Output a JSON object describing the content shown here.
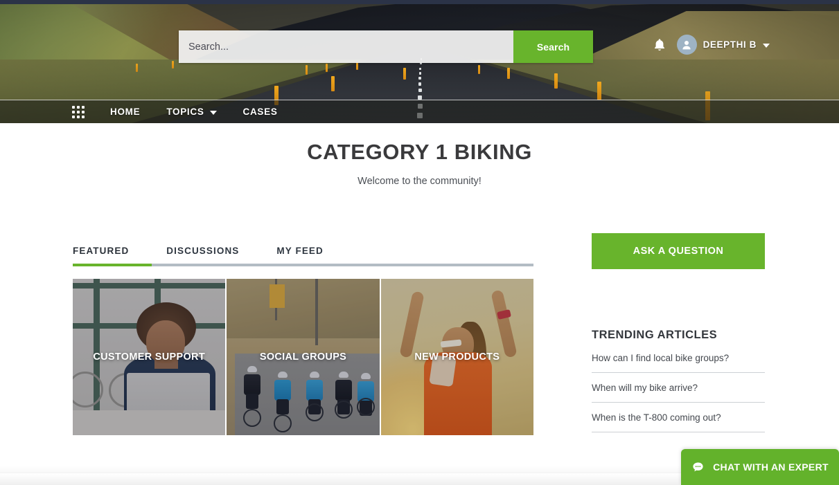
{
  "header": {
    "search": {
      "placeholder": "Search...",
      "value": "",
      "button_label": "Search"
    },
    "notifications_icon": "bell-icon",
    "user": {
      "name": "DEEPTHI B",
      "avatar_icon": "person-avatar-icon",
      "caret_icon": "chevron-down-icon"
    }
  },
  "nav": {
    "apps_icon": "waffle-grid-icon",
    "items": [
      {
        "label": "HOME",
        "has_caret": false
      },
      {
        "label": "TOPICS",
        "has_caret": true
      },
      {
        "label": "CASES",
        "has_caret": false
      }
    ]
  },
  "page": {
    "title": "CATEGORY 1 BIKING",
    "subtitle": "Welcome to the community!"
  },
  "tabs": [
    {
      "label": "FEATURED",
      "active": true
    },
    {
      "label": "DISCUSSIONS",
      "active": false
    },
    {
      "label": "MY FEED",
      "active": false
    }
  ],
  "cards": [
    {
      "label": "CUSTOMER SUPPORT"
    },
    {
      "label": "SOCIAL GROUPS"
    },
    {
      "label": "NEW PRODUCTS"
    }
  ],
  "sidebar": {
    "ask_button_label": "ASK A QUESTION",
    "trending_title": "TRENDING ARTICLES",
    "articles": [
      {
        "title": "How can I find local bike groups?"
      },
      {
        "title": "When will my bike arrive?"
      },
      {
        "title": "When is the T-800 coming out?"
      }
    ]
  },
  "chat": {
    "label": "CHAT WITH AN EXPERT",
    "icon": "chat-bubble-icon"
  },
  "colors": {
    "brand_green": "#68b42c",
    "chat_green": "#63b22b",
    "tab_rail": "#b3bcc4",
    "title_gray": "#3a3a3c",
    "top_strip": "#2b3347"
  }
}
